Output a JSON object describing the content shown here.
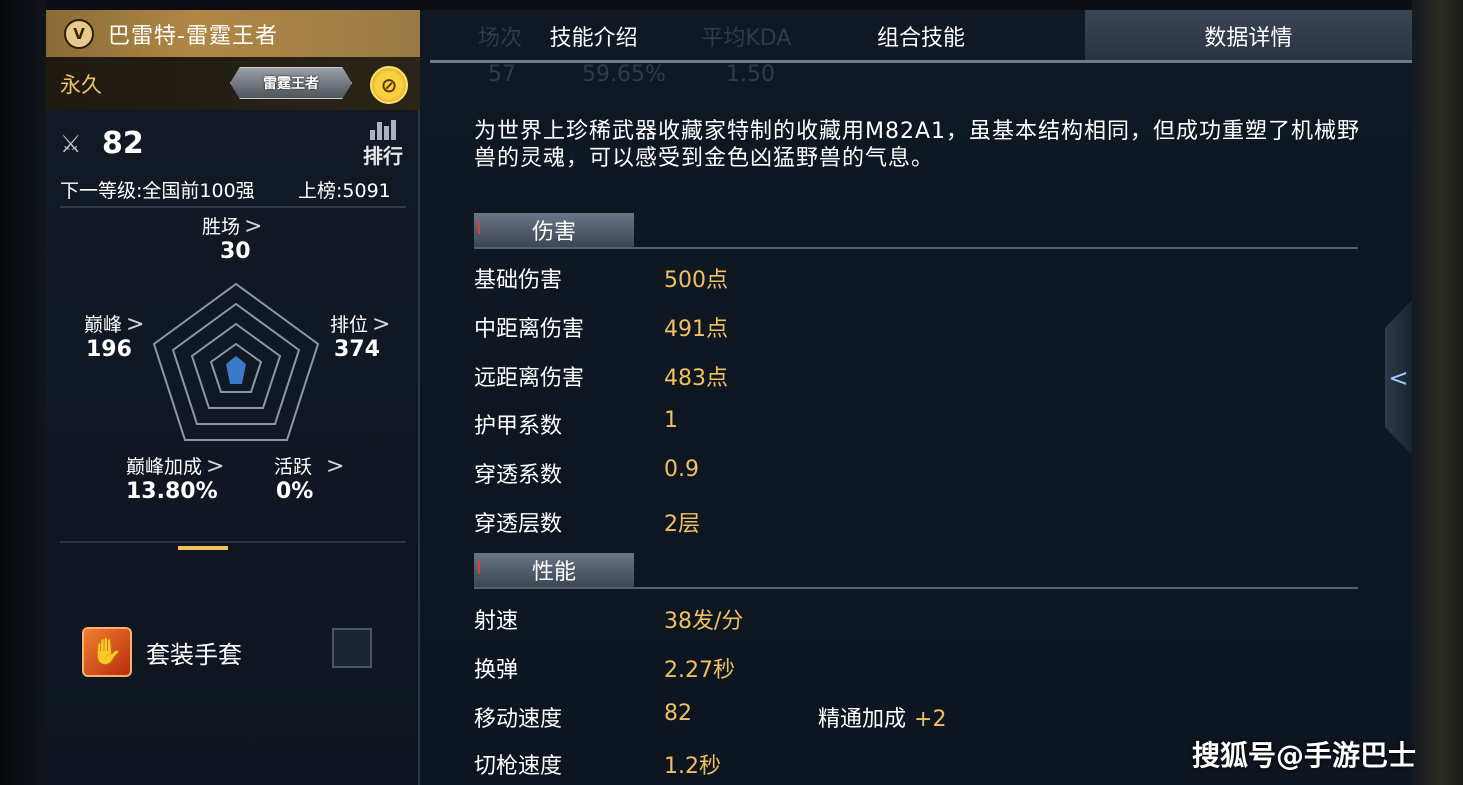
{
  "header": {
    "weapon_name": "巴雷特-雷霆王者",
    "rank_badge": "V",
    "duration": "永久",
    "tag_label": "雷霆王者",
    "coin_icon": "coin-icon"
  },
  "stats": {
    "level": "82",
    "rank_button_label": "排行",
    "next_level": "下一等级:全国前100强",
    "on_board": "上榜:5091"
  },
  "radar": {
    "wins": {
      "label": "胜场",
      "value": "30"
    },
    "peak": {
      "label": "巅峰",
      "value": "196"
    },
    "ranked": {
      "label": "排位",
      "value": "374"
    },
    "peak_bonus": {
      "label": "巅峰加成",
      "value": "13.80%"
    },
    "active": {
      "label": "活跃",
      "value": "0%"
    },
    "arrow": ">"
  },
  "glove": {
    "label": "套装手套",
    "checked": false
  },
  "tabs": [
    {
      "label": "技能介绍",
      "ghost": "场次"
    },
    {
      "label": "组合技能",
      "ghost": "平均KDA"
    },
    {
      "label": "数据详情",
      "active": true
    }
  ],
  "ghost_values": [
    "57",
    "59.65%",
    "1.50"
  ],
  "description": "为世界上珍稀武器收藏家特制的收藏用M82A1，虽基本结构相同，但成功重塑了机械野兽的灵魂，可以感受到金色凶猛野兽的气息。",
  "sections": [
    {
      "title": "伤害",
      "rows": [
        {
          "key": "基础伤害",
          "value": "500点"
        },
        {
          "key": "中距离伤害",
          "value": "491点"
        },
        {
          "key": "远距离伤害",
          "value": "483点"
        },
        {
          "key": "护甲系数",
          "value": "1"
        },
        {
          "key": "穿透系数",
          "value": "0.9"
        },
        {
          "key": "穿透层数",
          "value": "2层"
        }
      ]
    },
    {
      "title": "性能",
      "rows": [
        {
          "key": "射速",
          "value": "38发/分"
        },
        {
          "key": "换弹",
          "value": "2.27秒"
        },
        {
          "key": "移动速度",
          "value": "82",
          "extra_label": "精通加成",
          "extra_value": "+2"
        },
        {
          "key": "切枪速度",
          "value": "1.2秒"
        }
      ]
    }
  ],
  "side_handle": "<",
  "watermark": "搜狐号@手游巴士",
  "colors": {
    "gold_text": "#f0c060",
    "header_gold": "#b08845",
    "panel_bg": "#0f1823",
    "radar_fill": "#3a78c8"
  }
}
